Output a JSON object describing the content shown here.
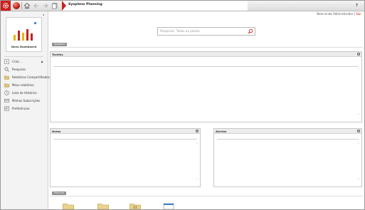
{
  "app": {
    "tab_title": "Syspleno Planning",
    "help_label": "?",
    "welcome": "Bem-vindo Administrador",
    "logout": "Sair",
    "logout_sep": "|"
  },
  "toolbar": {
    "icons": [
      "gear-icon",
      "logo-ball-icon",
      "home-icon",
      "back-icon",
      "forward-icon",
      "documents-icon"
    ]
  },
  "sidebar": {
    "collapse_glyph": "◂",
    "dashboard_label": "Novo Dashboard",
    "items": [
      {
        "label": "Criar...",
        "icon": "create-icon",
        "has_submenu": true
      },
      {
        "label": "Pesquisar",
        "icon": "search-icon"
      },
      {
        "label": "Relatórios Compartilhados",
        "icon": "shared-reports-icon"
      },
      {
        "label": "Meus relatórios",
        "icon": "my-reports-icon"
      },
      {
        "label": "Lista de Histórico",
        "icon": "history-icon"
      },
      {
        "label": "Minhas Subscrições",
        "icon": "subscriptions-icon"
      },
      {
        "label": "Preferências",
        "icon": "preferences-icon"
      }
    ],
    "submenu_glyph": "▶"
  },
  "search": {
    "placeholder": "Pesquisar: Todas as pastas"
  },
  "sections": {
    "main": "Syspleno",
    "browse": "Procurar"
  },
  "panels": {
    "tasks": {
      "title": "Tarefas"
    },
    "notes": {
      "title": "Notas"
    },
    "alerts": {
      "title": "Alertas"
    }
  },
  "scroll": {
    "up": "˄",
    "down": "˅"
  },
  "colors": {
    "accent": "#cc1f1f",
    "header_bg": "#ececec",
    "pill": "#8f8f8f"
  }
}
